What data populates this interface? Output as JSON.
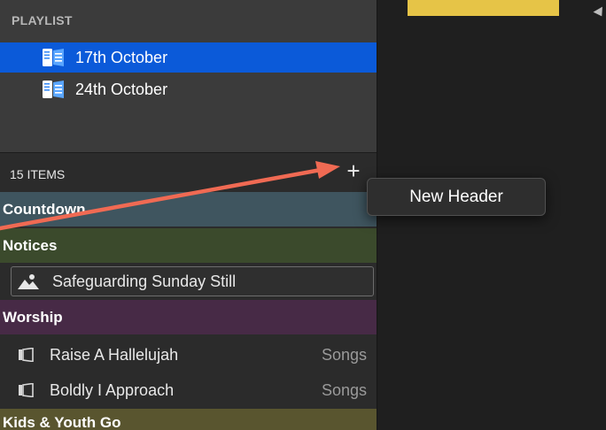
{
  "playlist": {
    "title": "PLAYLIST",
    "items": [
      {
        "label": "17th October",
        "selected": true
      },
      {
        "label": "24th October",
        "selected": false
      }
    ]
  },
  "items_panel": {
    "count_label": "15 ITEMS",
    "add_button": "+"
  },
  "headers": [
    {
      "label": "Countdown",
      "color": "#3f555f"
    },
    {
      "label": "Notices",
      "color": "#3b4a2c"
    },
    {
      "label": "Worship",
      "color": "#472a46"
    },
    {
      "label": "Kids & Youth Go",
      "color": "#59552f"
    }
  ],
  "items": {
    "still": {
      "label": "Safeguarding Sunday Still"
    },
    "songs": [
      {
        "label": "Raise A Hallelujah",
        "type": "Songs"
      },
      {
        "label": "Boldly I Approach",
        "type": "Songs"
      }
    ]
  },
  "tooltip": {
    "text": "New Header"
  },
  "colors": {
    "selection": "#0b5ad9",
    "arrow": "#f06a53",
    "tab_yellow": "#e6c447"
  }
}
